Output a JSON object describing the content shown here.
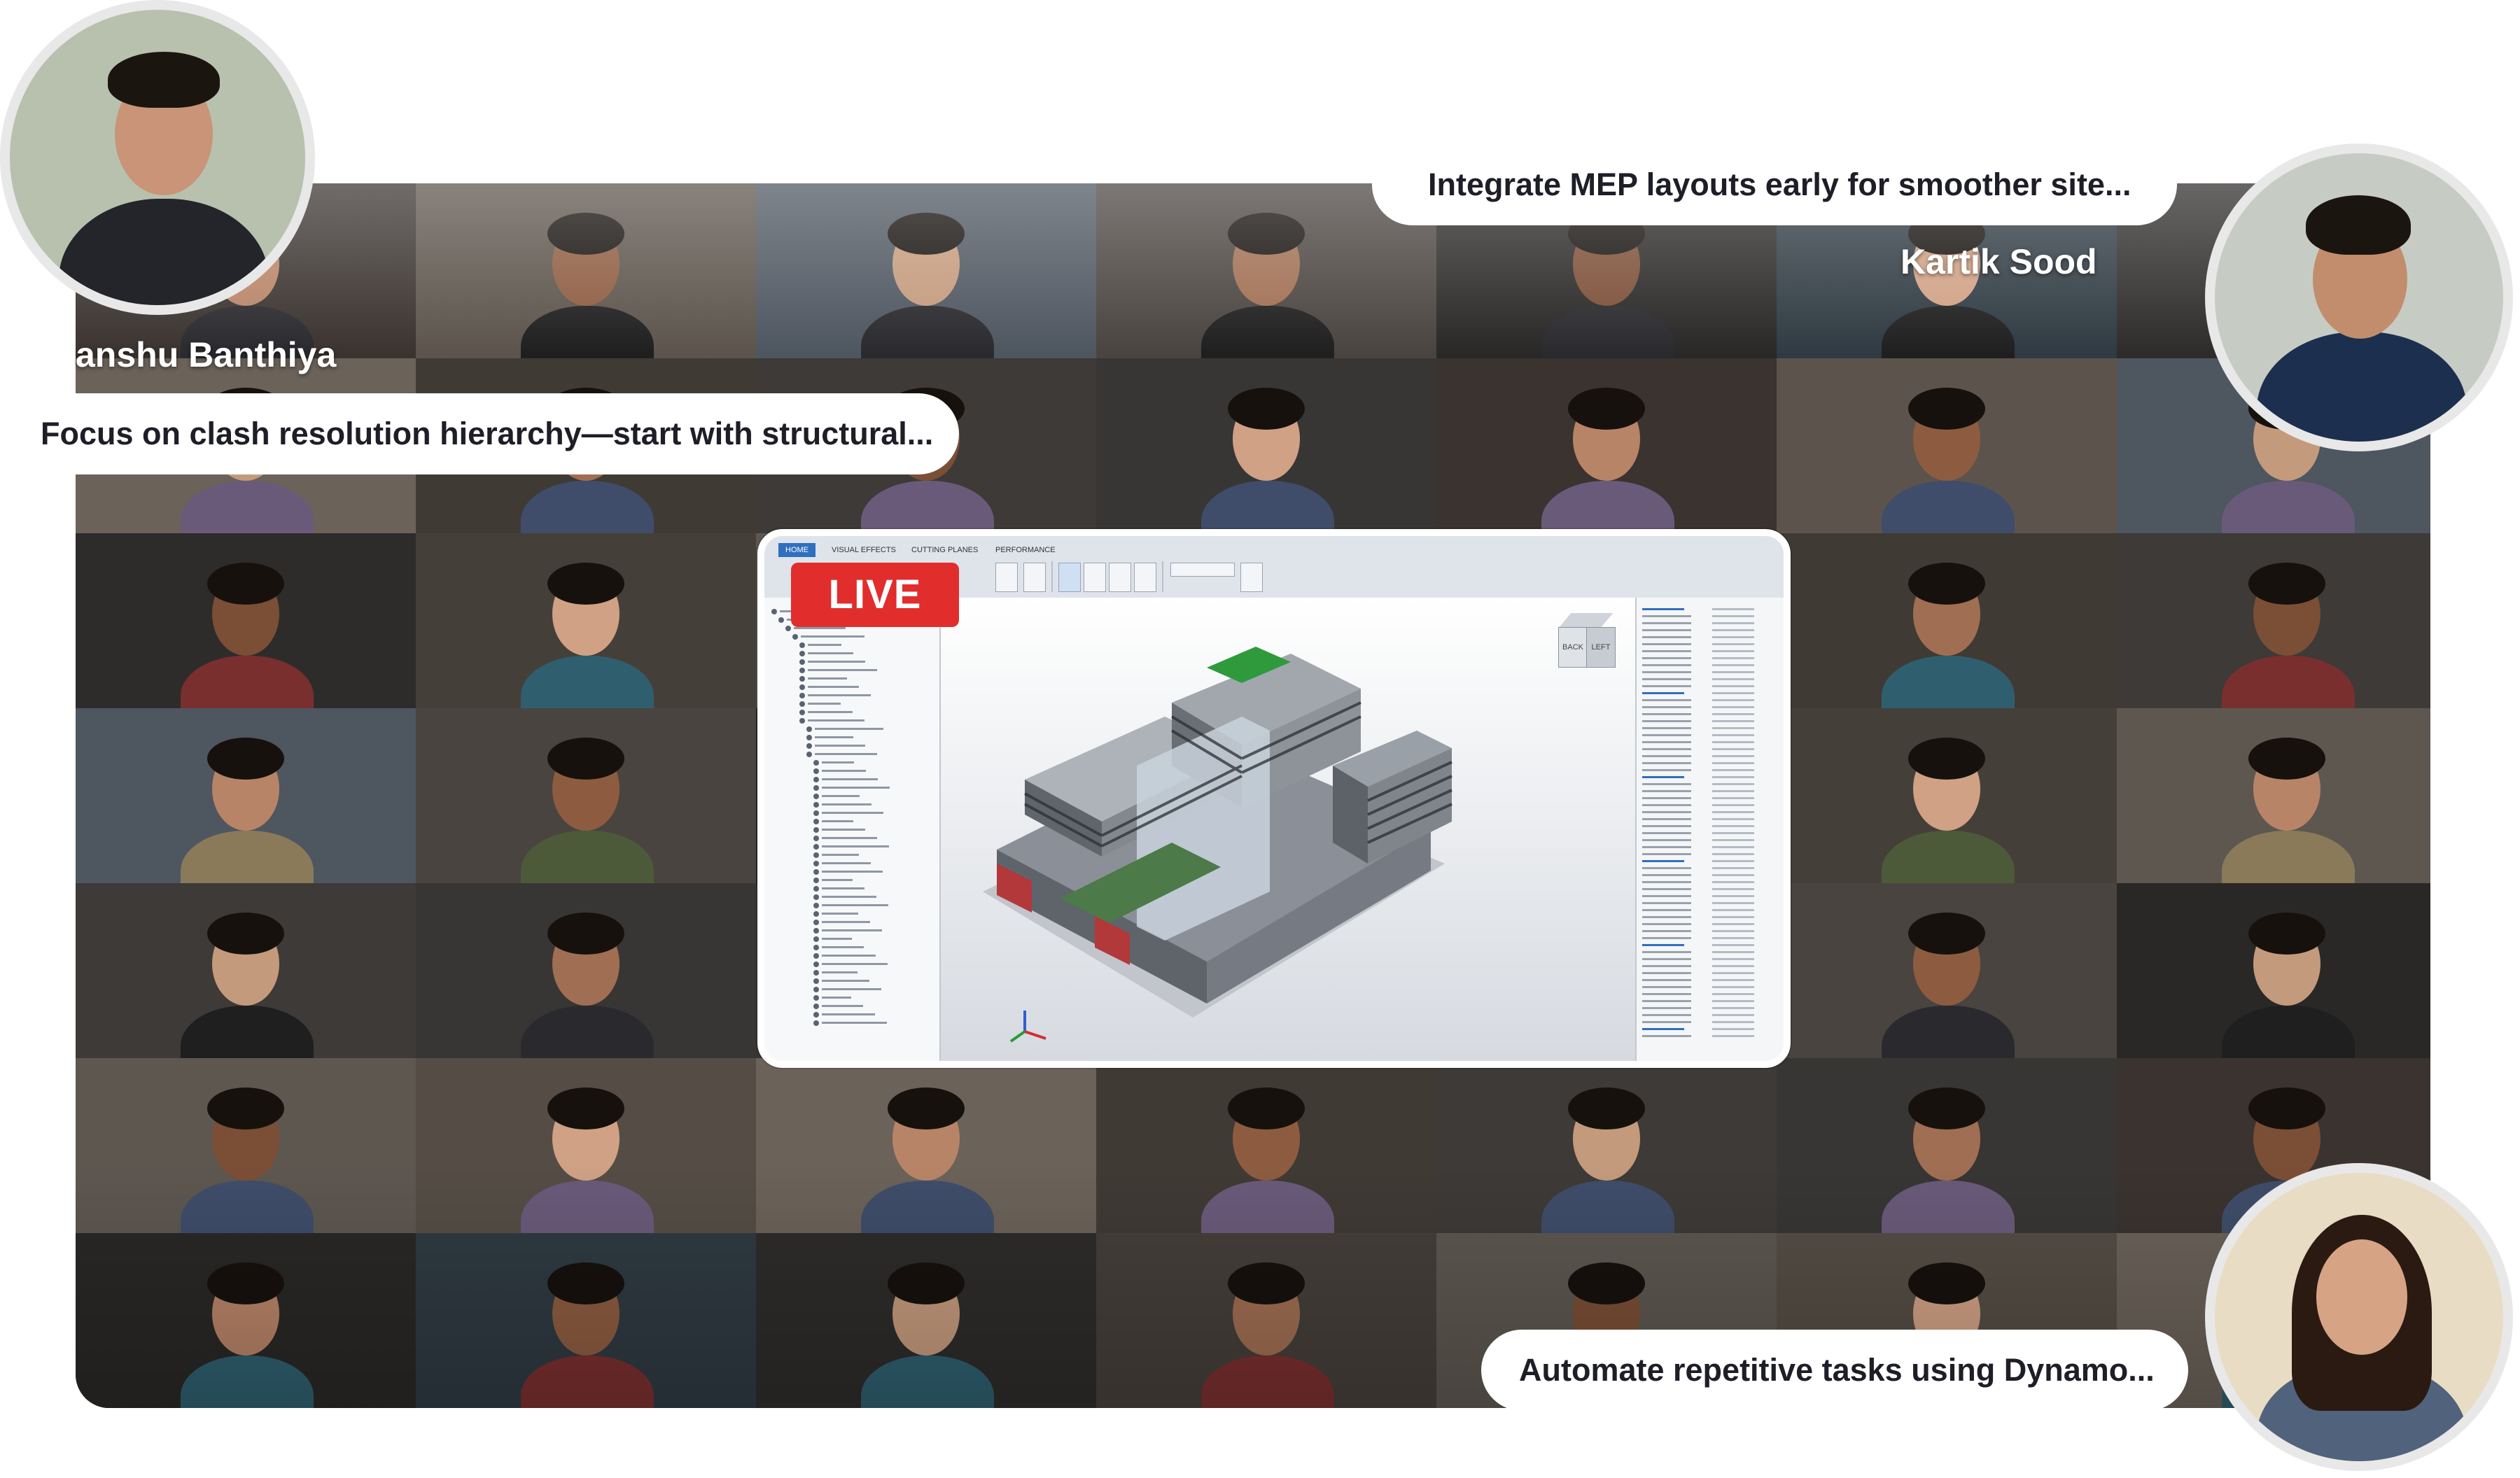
{
  "colors": {
    "live_badge": "#e22d2d",
    "bubble_bg": "#ffffff",
    "bubble_text": "#1e1e28",
    "name_text": "#ffffff"
  },
  "live_badge": {
    "label": "LIVE"
  },
  "speakers": [
    {
      "name": "anshu Banthiya",
      "comment": "Focus on clash resolution hierarchy—start with structural..."
    },
    {
      "name": "Kartik Sood",
      "comment": "Integrate MEP layouts early for smoother site..."
    },
    {
      "name": "",
      "comment": "Automate repetitive tasks using Dynamo..."
    }
  ],
  "screenshare": {
    "ribbon_tabs": [
      "HOME",
      "VISUAL EFFECTS",
      "CUTTING PLANES",
      "PERFORMANCE"
    ],
    "view_cube": {
      "face_left": "BACK",
      "face_right": "LEFT"
    }
  }
}
